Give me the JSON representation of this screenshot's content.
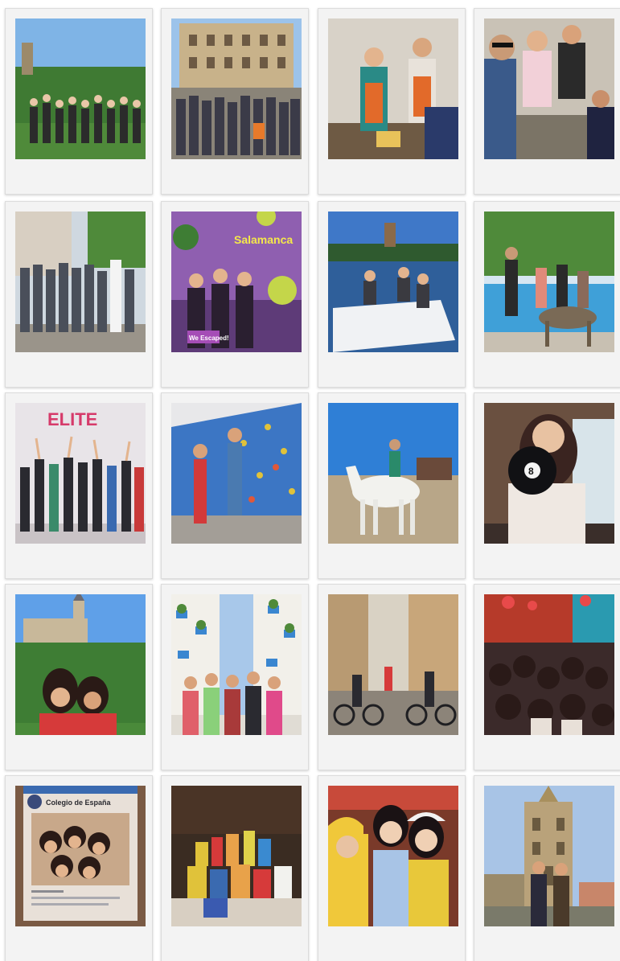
{
  "photos": [
    {
      "id": "p1",
      "scene": "group-park-castle",
      "sky": "#7fb4e6",
      "ground": "#4f8a3a"
    },
    {
      "id": "p2",
      "scene": "group-plaza-building",
      "sky": "#9cc3ea",
      "ground": "#8a8478"
    },
    {
      "id": "p3",
      "scene": "cooking-class",
      "sky": "#d8d2c8",
      "ground": "#6e5a44"
    },
    {
      "id": "p4",
      "scene": "friends-sitting",
      "sky": "#c9c2b6",
      "ground": "#7b7466"
    },
    {
      "id": "p5",
      "scene": "group-street",
      "sky": "#cfd8e0",
      "ground": "#9a948a"
    },
    {
      "id": "p6",
      "scene": "escape-room",
      "sky": "#8f5fb0",
      "ground": "#5e3b78",
      "texts": {
        "badge": "Salamanca",
        "sign": "We Escaped!"
      }
    },
    {
      "id": "p7",
      "scene": "pedal-boat-river",
      "sky": "#3f78c8",
      "ground": "#2f5f9a"
    },
    {
      "id": "p8",
      "scene": "pool-dog",
      "sky": "#d6e6f2",
      "ground": "#c8c0b2"
    },
    {
      "id": "p9",
      "scene": "dance-class",
      "sky": "#e8e4e8",
      "ground": "#c9c3c6",
      "texts": {
        "sign": "ELITE"
      }
    },
    {
      "id": "p10",
      "scene": "climbing-wall",
      "sky": "#3c76c4",
      "ground": "#a39e97"
    },
    {
      "id": "p11",
      "scene": "horse-riding",
      "sky": "#2f7fd6",
      "ground": "#b8a688"
    },
    {
      "id": "p12",
      "scene": "bowling-ball",
      "sky": "#6a5040",
      "ground": "#3a2e2a"
    },
    {
      "id": "p13",
      "scene": "two-friends-castle",
      "sky": "#5fa0e8",
      "ground": "#3e7d34"
    },
    {
      "id": "p14",
      "scene": "flower-street-group",
      "sky": "#a8c8ea",
      "ground": "#e0dcd4"
    },
    {
      "id": "p15",
      "scene": "bicycles-street",
      "sky": "#d9d2c4",
      "ground": "#8c8479"
    },
    {
      "id": "p16",
      "scene": "christmas-party",
      "sky": "#b63a2a",
      "ground": "#3b2a2a"
    },
    {
      "id": "p17",
      "scene": "instagram-frame",
      "sky": "#7a5a44",
      "ground": "#e8e0d8",
      "texts": {
        "title": "Colegio de España"
      }
    },
    {
      "id": "p18",
      "scene": "food-donation",
      "sky": "#3a2c22",
      "ground": "#d8cfc2"
    },
    {
      "id": "p19",
      "scene": "friends-yellow-hats",
      "sky": "#7a3a2a",
      "ground": "#e8c84a"
    },
    {
      "id": "p20",
      "scene": "cathedral-tower",
      "sky": "#a8c4e6",
      "ground": "#b9a27a"
    }
  ]
}
